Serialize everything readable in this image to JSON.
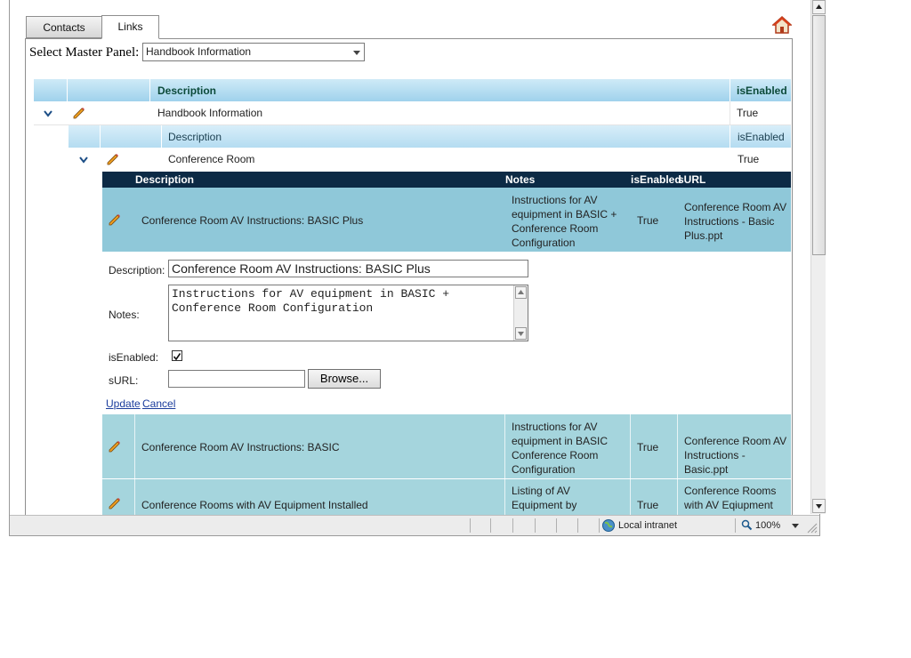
{
  "tabs": [
    {
      "label": "Contacts",
      "active": false
    },
    {
      "label": "Links",
      "active": true
    }
  ],
  "icons": {
    "home": "home-icon",
    "edit": "pencil-icon",
    "expand": "chevron-down-icon"
  },
  "master": {
    "label": "Select Master Panel:",
    "selected": "Handbook Information"
  },
  "outer_grid": {
    "headers": {
      "description": "Description",
      "enabled": "isEnabled"
    },
    "row": {
      "description": "Handbook Information",
      "enabled": "True"
    }
  },
  "inner_grid": {
    "headers": {
      "description": "Description",
      "enabled": "isEnabled"
    },
    "row": {
      "description": "Conference Room",
      "enabled": "True"
    }
  },
  "links_grid": {
    "headers": {
      "description": "Description",
      "notes": "Notes",
      "enabled": "isEnabled",
      "url": "sURL"
    },
    "selected_row": {
      "description": "Conference Room AV Instructions: BASIC Plus",
      "notes_lines": [
        "Instructions for AV",
        "equipment in BASIC +",
        "Conference Room",
        "Configuration"
      ],
      "enabled": "True",
      "url_lines": [
        "Conference Room AV",
        "Instructions - Basic",
        "Plus.ppt"
      ]
    },
    "rows": [
      {
        "description": "Conference Room AV Instructions: BASIC",
        "notes_lines": [
          "Instructions for AV",
          "equipment in BASIC",
          "Conference Room",
          "Configuration"
        ],
        "enabled": "True",
        "url_lines": [
          "Conference Room AV",
          "Instructions - Basic.ppt"
        ]
      },
      {
        "description": "Conference Rooms with AV Equipment Installed",
        "notes_lines": [
          "Listing of AV",
          "Equipment by"
        ],
        "enabled": "True",
        "url_lines": [
          "Conference Rooms",
          "with AV Eqiupment"
        ]
      }
    ]
  },
  "edit_form": {
    "description_label": "Description:",
    "description_value": "Conference Room AV Instructions: BASIC Plus",
    "notes_label": "Notes:",
    "notes_lines": [
      "Instructions for AV equipment in BASIC +",
      "Conference Room Configuration"
    ],
    "enabled_label": "isEnabled:",
    "enabled_checked": true,
    "url_label": "sURL:",
    "url_value": "",
    "browse_label": "Browse...",
    "update_label": "Update",
    "cancel_label": "Cancel"
  },
  "statusbar": {
    "zone": "Local intranet",
    "zoom": "100%"
  },
  "colors": {
    "header_blue": "#a9d8ef",
    "dark_header": "#0c2a45",
    "teal_row": "#a5d5dd",
    "link": "#1a3c9c"
  }
}
